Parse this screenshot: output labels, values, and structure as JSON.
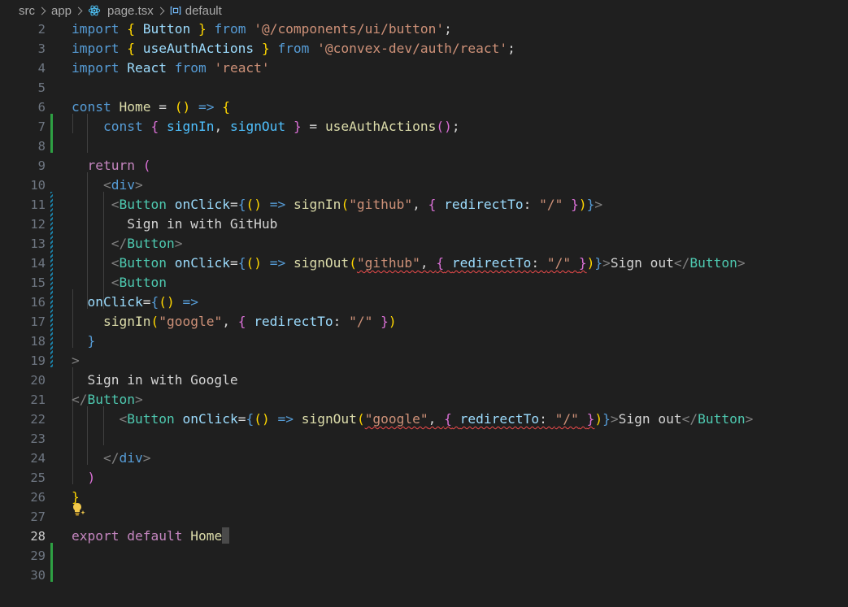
{
  "breadcrumb": {
    "items": [
      {
        "label": "src",
        "icon": null
      },
      {
        "label": "app",
        "icon": null
      },
      {
        "label": "page.tsx",
        "icon": "react-icon"
      },
      {
        "label": "default",
        "icon": "symbol-variable-icon"
      }
    ]
  },
  "editor": {
    "active_line": 28,
    "lines": [
      {
        "n": "2",
        "tokens": [
          [
            "kw",
            "import"
          ],
          [
            "plain",
            " "
          ],
          [
            "b1",
            "{"
          ],
          [
            "plain",
            " "
          ],
          [
            "var",
            "Button"
          ],
          [
            "plain",
            " "
          ],
          [
            "b1",
            "}"
          ],
          [
            "plain",
            " "
          ],
          [
            "kw",
            "from"
          ],
          [
            "plain",
            " "
          ],
          [
            "str",
            "'@/components/ui/button'"
          ],
          [
            "plain",
            ";"
          ]
        ]
      },
      {
        "n": "3",
        "tokens": [
          [
            "kw",
            "import"
          ],
          [
            "plain",
            " "
          ],
          [
            "b1",
            "{"
          ],
          [
            "plain",
            " "
          ],
          [
            "var",
            "useAuthActions"
          ],
          [
            "plain",
            " "
          ],
          [
            "b1",
            "}"
          ],
          [
            "plain",
            " "
          ],
          [
            "kw",
            "from"
          ],
          [
            "plain",
            " "
          ],
          [
            "str",
            "'@convex-dev/auth/react'"
          ],
          [
            "plain",
            ";"
          ]
        ]
      },
      {
        "n": "4",
        "tokens": [
          [
            "kw",
            "import"
          ],
          [
            "plain",
            " "
          ],
          [
            "var",
            "React"
          ],
          [
            "plain",
            " "
          ],
          [
            "kw",
            "from"
          ],
          [
            "plain",
            " "
          ],
          [
            "str",
            "'react'"
          ]
        ]
      },
      {
        "n": "5",
        "tokens": []
      },
      {
        "n": "6",
        "tokens": [
          [
            "kw",
            "const"
          ],
          [
            "plain",
            " "
          ],
          [
            "fn",
            "Home"
          ],
          [
            "plain",
            " = "
          ],
          [
            "b1",
            "()"
          ],
          [
            "plain",
            " "
          ],
          [
            "kw",
            "=>"
          ],
          [
            "plain",
            " "
          ],
          [
            "b1",
            "{"
          ]
        ]
      },
      {
        "n": "7",
        "tokens": [
          [
            "plain",
            "    "
          ],
          [
            "kw",
            "const"
          ],
          [
            "plain",
            " "
          ],
          [
            "b2",
            "{"
          ],
          [
            "plain",
            " "
          ],
          [
            "cn",
            "signIn"
          ],
          [
            "plain",
            ", "
          ],
          [
            "cn",
            "signOut"
          ],
          [
            "plain",
            " "
          ],
          [
            "b2",
            "}"
          ],
          [
            "plain",
            " = "
          ],
          [
            "fn",
            "useAuthActions"
          ],
          [
            "b2",
            "()"
          ],
          [
            "plain",
            ";"
          ]
        ]
      },
      {
        "n": "8",
        "tokens": []
      },
      {
        "n": "9",
        "tokens": [
          [
            "plain",
            "  "
          ],
          [
            "ctl",
            "return"
          ],
          [
            "plain",
            " "
          ],
          [
            "b2",
            "("
          ]
        ]
      },
      {
        "n": "10",
        "tokens": [
          [
            "plain",
            "    "
          ],
          [
            "pt",
            "<"
          ],
          [
            "kw",
            "div"
          ],
          [
            "pt",
            ">"
          ]
        ]
      },
      {
        "n": "11",
        "tokens": [
          [
            "plain",
            "     "
          ],
          [
            "pt",
            "<"
          ],
          [
            "tag",
            "Button"
          ],
          [
            "plain",
            " "
          ],
          [
            "var",
            "onClick"
          ],
          [
            "plain",
            "="
          ],
          [
            "kw",
            "{"
          ],
          [
            "b1",
            "()"
          ],
          [
            "plain",
            " "
          ],
          [
            "kw",
            "=>"
          ],
          [
            "plain",
            " "
          ],
          [
            "fn",
            "signIn"
          ],
          [
            "b1",
            "("
          ],
          [
            "str",
            "\"github\""
          ],
          [
            "plain",
            ", "
          ],
          [
            "b2",
            "{"
          ],
          [
            "plain",
            " "
          ],
          [
            "var",
            "redirectTo"
          ],
          [
            "plain",
            ": "
          ],
          [
            "str",
            "\"/\""
          ],
          [
            "plain",
            " "
          ],
          [
            "b2",
            "}"
          ],
          [
            "b1",
            ")"
          ],
          [
            "kw",
            "}"
          ],
          [
            "pt",
            ">"
          ]
        ]
      },
      {
        "n": "12",
        "tokens": [
          [
            "plain",
            "       Sign in with GitHub"
          ]
        ]
      },
      {
        "n": "13",
        "tokens": [
          [
            "plain",
            "     "
          ],
          [
            "pt",
            "</"
          ],
          [
            "tag",
            "Button"
          ],
          [
            "pt",
            ">"
          ]
        ]
      },
      {
        "n": "14",
        "tokens": [
          [
            "plain",
            "     "
          ],
          [
            "pt",
            "<"
          ],
          [
            "tag",
            "Button"
          ],
          [
            "plain",
            " "
          ],
          [
            "var",
            "onClick"
          ],
          [
            "plain",
            "="
          ],
          [
            "kw",
            "{"
          ],
          [
            "b1",
            "()"
          ],
          [
            "plain",
            " "
          ],
          [
            "kw",
            "=>"
          ],
          [
            "plain",
            " "
          ],
          [
            "fn",
            "signOut"
          ],
          [
            "b1",
            "("
          ],
          [
            "str squiggle",
            "\"github\""
          ],
          [
            "plain squiggle",
            ", "
          ],
          [
            "b2 squiggle",
            "{"
          ],
          [
            "plain squiggle",
            " "
          ],
          [
            "var squiggle",
            "redirectTo"
          ],
          [
            "plain squiggle",
            ": "
          ],
          [
            "str squiggle",
            "\"/\""
          ],
          [
            "plain squiggle",
            " "
          ],
          [
            "b2 squiggle",
            "}"
          ],
          [
            "b1",
            ")"
          ],
          [
            "kw",
            "}"
          ],
          [
            "pt",
            ">"
          ],
          [
            "plain",
            "Sign out"
          ],
          [
            "pt",
            "</"
          ],
          [
            "tag",
            "Button"
          ],
          [
            "pt",
            ">"
          ]
        ]
      },
      {
        "n": "15",
        "tokens": [
          [
            "plain",
            "     "
          ],
          [
            "pt",
            "<"
          ],
          [
            "tag",
            "Button"
          ]
        ]
      },
      {
        "n": "16",
        "tokens": [
          [
            "plain",
            "  "
          ],
          [
            "var",
            "onClick"
          ],
          [
            "plain",
            "="
          ],
          [
            "kw",
            "{"
          ],
          [
            "b1",
            "()"
          ],
          [
            "plain",
            " "
          ],
          [
            "kw",
            "=>"
          ]
        ]
      },
      {
        "n": "17",
        "tokens": [
          [
            "plain",
            "    "
          ],
          [
            "fn",
            "signIn"
          ],
          [
            "b1",
            "("
          ],
          [
            "str",
            "\"google\""
          ],
          [
            "plain",
            ", "
          ],
          [
            "b2",
            "{"
          ],
          [
            "plain",
            " "
          ],
          [
            "var",
            "redirectTo"
          ],
          [
            "plain",
            ": "
          ],
          [
            "str",
            "\"/\""
          ],
          [
            "plain",
            " "
          ],
          [
            "b2",
            "}"
          ],
          [
            "b1",
            ")"
          ]
        ]
      },
      {
        "n": "18",
        "tokens": [
          [
            "plain",
            "  "
          ],
          [
            "kw",
            "}"
          ]
        ]
      },
      {
        "n": "19",
        "tokens": [
          [
            "pt",
            ">"
          ]
        ]
      },
      {
        "n": "20",
        "tokens": [
          [
            "plain",
            "  Sign in with Google"
          ]
        ]
      },
      {
        "n": "21",
        "tokens": [
          [
            "pt",
            "</"
          ],
          [
            "tag",
            "Button"
          ],
          [
            "pt",
            ">"
          ]
        ]
      },
      {
        "n": "22",
        "tokens": [
          [
            "plain",
            "      "
          ],
          [
            "pt",
            "<"
          ],
          [
            "tag",
            "Button"
          ],
          [
            "plain",
            " "
          ],
          [
            "var",
            "onClick"
          ],
          [
            "plain",
            "="
          ],
          [
            "kw",
            "{"
          ],
          [
            "b1",
            "()"
          ],
          [
            "plain",
            " "
          ],
          [
            "kw",
            "=>"
          ],
          [
            "plain",
            " "
          ],
          [
            "fn",
            "signOut"
          ],
          [
            "b1",
            "("
          ],
          [
            "str squiggle",
            "\"google\""
          ],
          [
            "plain squiggle",
            ", "
          ],
          [
            "b2 squiggle",
            "{"
          ],
          [
            "plain squiggle",
            " "
          ],
          [
            "var squiggle",
            "redirectTo"
          ],
          [
            "plain squiggle",
            ": "
          ],
          [
            "str squiggle",
            "\"/\""
          ],
          [
            "plain squiggle",
            " "
          ],
          [
            "b2 squiggle",
            "}"
          ],
          [
            "b1",
            ")"
          ],
          [
            "kw",
            "}"
          ],
          [
            "pt",
            ">"
          ],
          [
            "plain",
            "Sign out"
          ],
          [
            "pt",
            "</"
          ],
          [
            "tag",
            "Button"
          ],
          [
            "pt",
            ">"
          ]
        ]
      },
      {
        "n": "23",
        "tokens": []
      },
      {
        "n": "24",
        "tokens": [
          [
            "plain",
            "    "
          ],
          [
            "pt",
            "</"
          ],
          [
            "kw",
            "div"
          ],
          [
            "pt",
            ">"
          ]
        ]
      },
      {
        "n": "25",
        "tokens": [
          [
            "plain",
            "  "
          ],
          [
            "b2",
            ")"
          ]
        ]
      },
      {
        "n": "26",
        "tokens": [
          [
            "b1",
            "}"
          ]
        ]
      },
      {
        "n": "27",
        "tokens": []
      },
      {
        "n": "28",
        "tokens": [
          [
            "ctl",
            "export"
          ],
          [
            "plain",
            " "
          ],
          [
            "ctl",
            "default"
          ],
          [
            "plain",
            " "
          ],
          [
            "fn",
            "Home"
          ]
        ]
      },
      {
        "n": "29",
        "tokens": []
      },
      {
        "n": "30",
        "tokens": []
      }
    ]
  }
}
